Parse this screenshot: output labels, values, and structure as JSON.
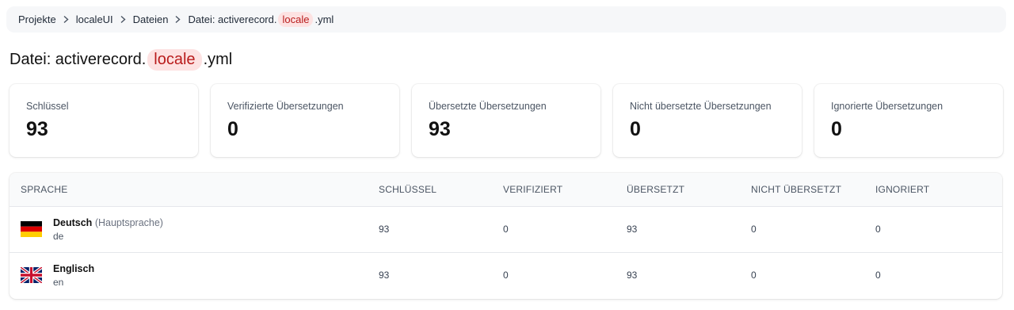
{
  "breadcrumb": {
    "items": [
      "Projekte",
      "localeUI",
      "Dateien"
    ],
    "current_prefix": "Datei: activerecord.",
    "current_key": "locale",
    "current_suffix": ".yml"
  },
  "title": {
    "prefix": "Datei: activerecord.",
    "key": "locale",
    "suffix": ".yml"
  },
  "stats": [
    {
      "label": "Schlüssel",
      "value": "93"
    },
    {
      "label": "Verifizierte Übersetzungen",
      "value": "0"
    },
    {
      "label": "Übersetzte Übersetzungen",
      "value": "93"
    },
    {
      "label": "Nicht übersetzte Übersetzungen",
      "value": "0"
    },
    {
      "label": "Ignorierte Übersetzungen",
      "value": "0"
    }
  ],
  "table": {
    "headers": [
      "SPRACHE",
      "SCHLÜSSEL",
      "VERIFIZIERT",
      "ÜBERSETZT",
      "NICHT ÜBERSETZT",
      "IGNORIERT"
    ],
    "rows": [
      {
        "name": "Deutsch",
        "hint": "(Hauptsprache)",
        "code": "de",
        "flag_icon": "germany-flag-icon",
        "keys": "93",
        "verified": "0",
        "translated": "93",
        "not_translated": "0",
        "ignored": "0"
      },
      {
        "name": "Englisch",
        "hint": "",
        "code": "en",
        "flag_icon": "uk-flag-icon",
        "keys": "93",
        "verified": "0",
        "translated": "93",
        "not_translated": "0",
        "ignored": "0"
      }
    ]
  },
  "colors": {
    "key_highlight_bg": "#fde2e2",
    "key_highlight_text": "#b91c1c"
  }
}
